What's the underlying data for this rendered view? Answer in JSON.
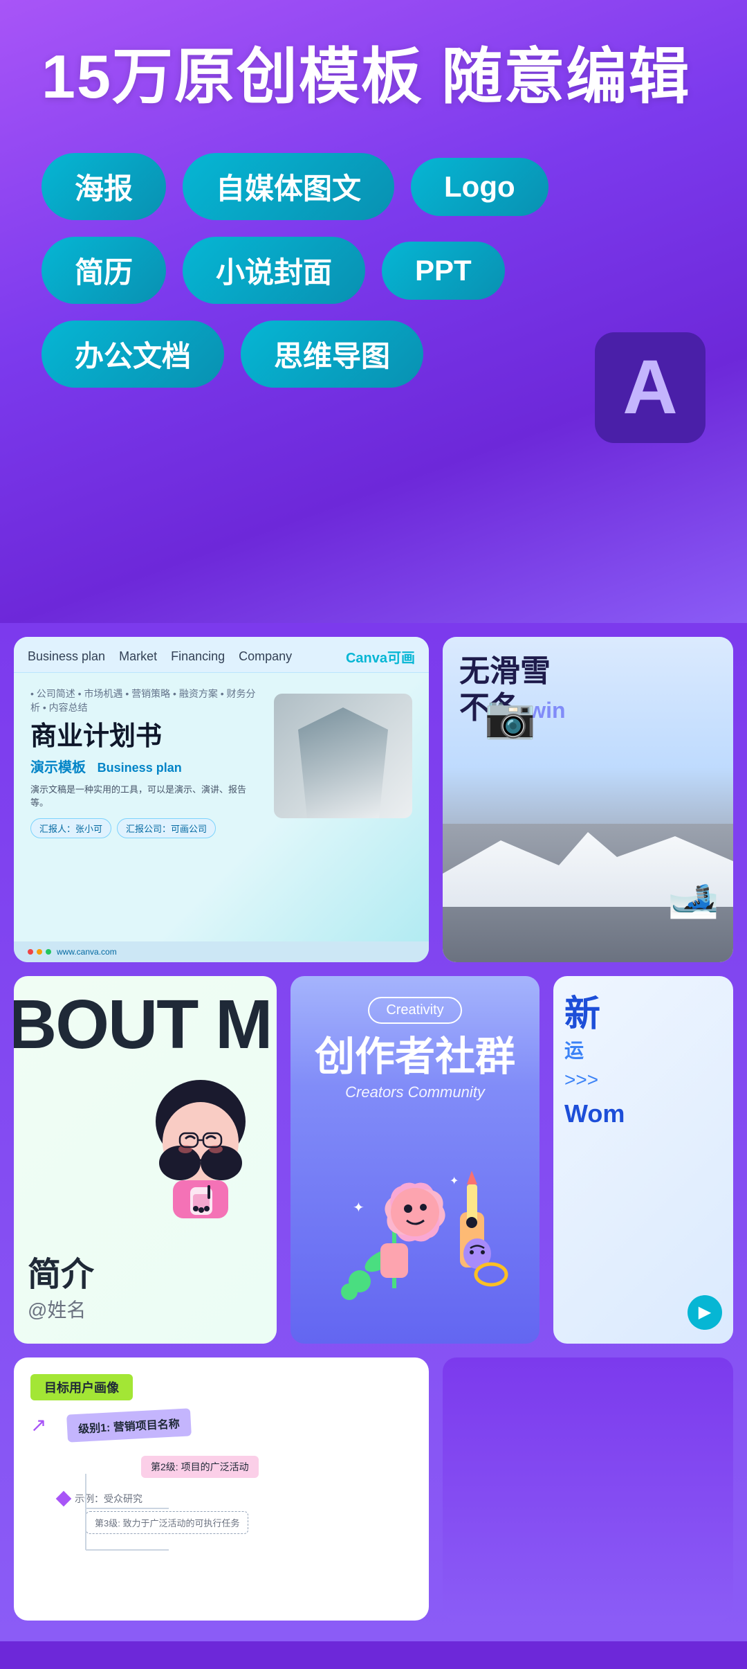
{
  "hero": {
    "title": "15万原创模板 随意编辑",
    "tags_row1": [
      "海报",
      "自媒体图文",
      "Logo"
    ],
    "tags_row2": [
      "简历",
      "小说封面",
      "PPT"
    ],
    "tags_row3": [
      "办公文档",
      "思维导图"
    ]
  },
  "cards": {
    "business": {
      "nav_items": [
        "Business plan",
        "Market",
        "Financing",
        "Company"
      ],
      "logo": "Canva可画",
      "breadcrumb": "• 公司简述 • 市场机遇 • 营销策略 • 融资方案 • 财务分析 • 内容总结",
      "main_title": "商业计划书",
      "subtitle_cn": "演示模板",
      "subtitle_en": "Business plan",
      "desc": "演示文稿是一种实用的工具，可以是演示、演讲、报告等。",
      "tag1": "汇报人：张小可",
      "tag2": "汇报公司：可画公司",
      "url": "www.canva.com"
    },
    "snow": {
      "title_line1": "无滑雪",
      "title_line2": "不冬",
      "win_text": "win"
    },
    "about": {
      "bg_text": "BOUT M",
      "label": "简介",
      "username": "@姓名"
    },
    "creativity": {
      "badge": "Creativity",
      "title": "创作者社群",
      "subtitle": "Creators Community"
    },
    "wom": {
      "title_line1": "新",
      "title_line2": "运",
      "arrows": ">>>"
    },
    "mindmap": {
      "label": "目标用户画像",
      "node1": "级别1: 营销项目名称",
      "node2": "第2级: 项目的广泛活动",
      "node3": "示例：受众研究",
      "node4": "第3级: 致力于广泛活动的可执行任务"
    }
  },
  "colors": {
    "hero_bg": "#8b5cf6",
    "tag_bg": "#06b6d4",
    "card_blue": "#dbeafe",
    "adobe_bg": "#4a1fa8",
    "adobe_text": "#c4b5fd"
  }
}
